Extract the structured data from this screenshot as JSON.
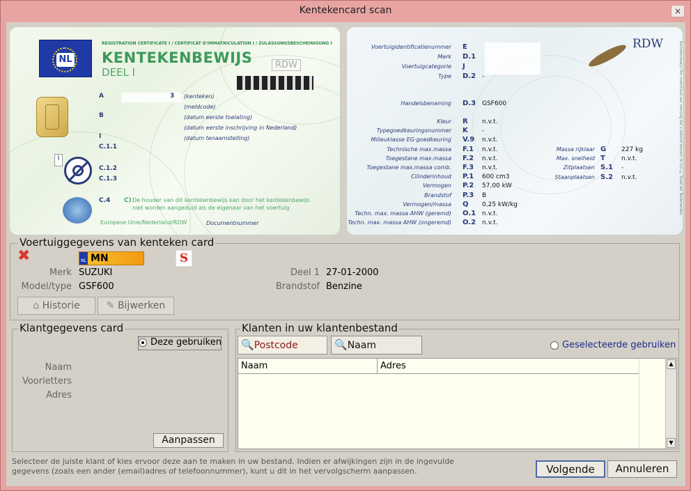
{
  "window": {
    "title": "Kentekencard scan",
    "close": "×"
  },
  "card_front": {
    "header": "REGISTRATION CERTIFICATE I / CERTIFICAT D'IMMATRICULATION I / ZULASSUNGSBESCHEINIGUNG I",
    "country": "NL",
    "title": "KENTEKENBEWIJS",
    "subtitle": "DEEL I",
    "rdw": "RDW",
    "rows": [
      {
        "code": "A",
        "value": "3",
        "label": "(kenteken)"
      },
      {
        "code": "",
        "value": "",
        "label": "(meldcode)"
      },
      {
        "code": "B",
        "value": "",
        "label": "(datum eerste toelating)"
      },
      {
        "code": "",
        "value": "",
        "label": "(datum eerste inschrijving in Nederland)"
      },
      {
        "code": "I",
        "value": "",
        "label": "(datum tenaamstelling)"
      }
    ],
    "c_codes": [
      "C.1.1",
      "C.1.2",
      "C.1.3",
      "C.4"
    ],
    "roman": "I",
    "c4_letter": "C)",
    "c4_text1": "De houder van dit kentekenbewijs kan door het kentekenbewijs",
    "c4_text2": "niet worden aangeduid als de eigenaar van het voertuig",
    "footer": "Europese Unie/Nederland/RDW",
    "doc": "Documentnummer"
  },
  "card_back": {
    "rdw": "RDW",
    "top_rows": [
      {
        "label": "Voertuigidentificatienummer",
        "code": "E",
        "value": ""
      },
      {
        "label": "Merk",
        "code": "D.1",
        "value": ""
      },
      {
        "label": "Voertuigcategorie",
        "code": "J",
        "value": ""
      },
      {
        "label": "Type",
        "code": "D.2",
        "value": "-"
      }
    ],
    "handels": {
      "label": "Handelsbenaming",
      "code": "D.3",
      "value": "GSF600"
    },
    "rows": [
      {
        "label": "Kleur",
        "code": "R",
        "value": "n.v.t."
      },
      {
        "label": "Typegoedkeuringsnummer",
        "code": "K",
        "value": "-"
      },
      {
        "label": "Milieuklasse EG-goedkeuring",
        "code": "V.9",
        "value": "n.v.t."
      },
      {
        "label": "Technische max.massa",
        "code": "F.1",
        "value": "n.v.t."
      },
      {
        "label": "Toegestane max.massa",
        "code": "F.2",
        "value": "n.v.t."
      },
      {
        "label": "Toegestane max.massa comb.",
        "code": "F.3",
        "value": "n.v.t."
      },
      {
        "label": "Cilinderinhoud",
        "code": "P.1",
        "value": "600 cm3"
      },
      {
        "label": "Vermogen",
        "code": "P.2",
        "value": "57,00 kW"
      },
      {
        "label": "Brandstof",
        "code": "P.3",
        "value": "B"
      },
      {
        "label": "Vermogen/massa",
        "code": "Q",
        "value": "0,25 kW/kg"
      },
      {
        "label": "Techn. max. massa AHW (geremd)",
        "code": "O.1",
        "value": "n.v.t."
      },
      {
        "label": "Techn. max. massa AHW (ongeremd)",
        "code": "O.2",
        "value": "n.v.t."
      }
    ],
    "right_rows": [
      {
        "label": "Massa rijklaar",
        "code": "G",
        "value": "227 kg"
      },
      {
        "label": "Max. snelheid",
        "code": "T",
        "value": "n.v.t."
      },
      {
        "label": "Zitplaatsen",
        "code": "S.1",
        "value": "-"
      },
      {
        "label": "Staanplaatsen",
        "code": "S.2",
        "value": "n.v.t."
      }
    ],
    "side": "Kentekenbewijs Het onderhoud aan voertuig dat u bekend behoort te zijn © Staat der Nederlanden"
  },
  "vehicle": {
    "group_title": "Voertuiggegevens van kenteken card",
    "plate": "MN",
    "plate_country": "NL",
    "merk_label": "Merk",
    "merk": "SUZUKI",
    "model_label": "Model/type",
    "model": "GSF600",
    "deel1_label": "Deel 1",
    "deel1": "27-01-2000",
    "brandstof_label": "Brandstof",
    "brandstof": "Benzine",
    "historie": "Historie",
    "bijwerken": "Bijwerken"
  },
  "customer_card": {
    "group_title": "Klantgegevens card",
    "use_label": "Deze gebruiken",
    "naam": "Naam",
    "voorletters": "Voorletters",
    "adres": "Adres",
    "aanpassen": "Aanpassen"
  },
  "customers": {
    "group_title": "Klanten in uw klantenbestand",
    "postcode": "Postcode",
    "naam_btn": "Naam",
    "selected_label": "Geselecteerde gebruiken",
    "col_naam": "Naam",
    "col_adres": "Adres"
  },
  "footer": {
    "line1": "Selecteer de juiste klant of kies ervoor deze aan te maken in uw bestand. Indien er afwijkingen zijn in de ingevulde",
    "line2": "gegevens (zoals een ander (email)adres of telefoonnummer), kunt u dit in het vervolgscherm aanpassen.",
    "next": "Volgende",
    "cancel": "Annuleren"
  },
  "colors": {
    "window": "#e8a4a2",
    "client": "#d4d0c8",
    "card_green": "#3c9a5a",
    "card_blue": "#2a3b77",
    "grid_bg": "#fffff0"
  }
}
